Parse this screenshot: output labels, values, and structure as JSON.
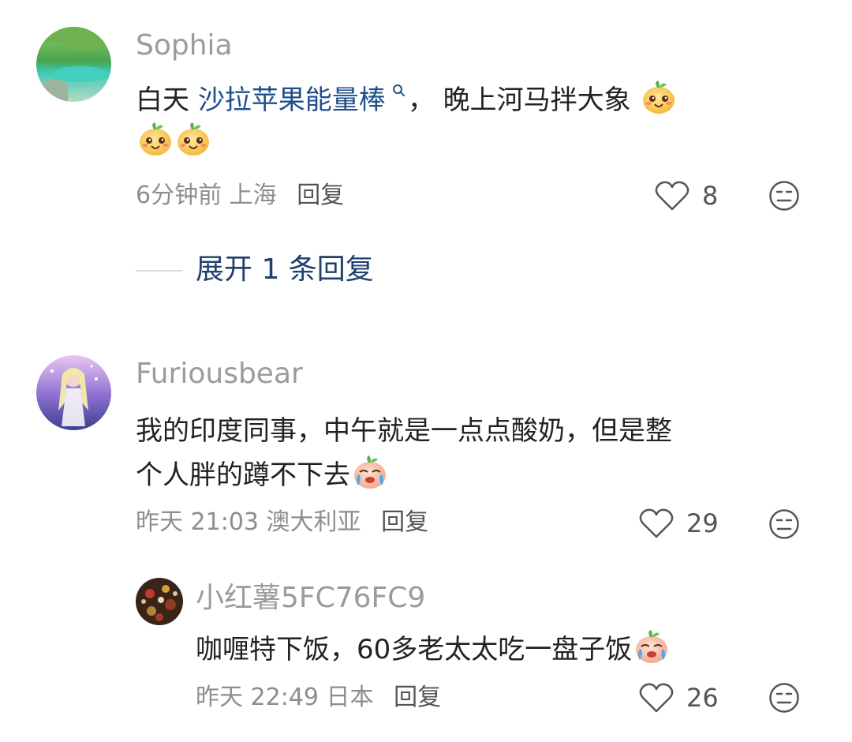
{
  "comments": [
    {
      "username": "Sophia",
      "text_before": "白天 ",
      "keyword": "沙拉苹果能量棒",
      "text_after": "， 晚上河马拌大象",
      "time": "6分钟前",
      "location": "上海",
      "reply_label": "回复",
      "likes": "8",
      "expand_label": "展开 1 条回复",
      "emoji_count": 3
    },
    {
      "username": "Furiousbear",
      "text_line1": "我的印度同事，中午就是一点点酸奶，但是整",
      "text_line2": "个人胖的蹲不下去",
      "time": "昨天 21:03",
      "location": "澳大利亚",
      "reply_label": "回复",
      "likes": "29"
    },
    {
      "username": "小红薯5FC76FC9",
      "text": "咖喱特下饭，60多老太太吃一盘子饭",
      "time": "昨天 22:49",
      "location": "日本",
      "reply_label": "回复",
      "likes": "26"
    }
  ],
  "icons": {
    "like": "heart-outline-icon",
    "dislike": "meh-face-icon",
    "search": "search-icon",
    "emoji_happy": "happy-mango-emoji",
    "emoji_cry": "crying-mango-emoji"
  },
  "colors": {
    "username": "#9b9b9b",
    "keyword": "#1f4e8c",
    "expand": "#1f3f6e"
  }
}
